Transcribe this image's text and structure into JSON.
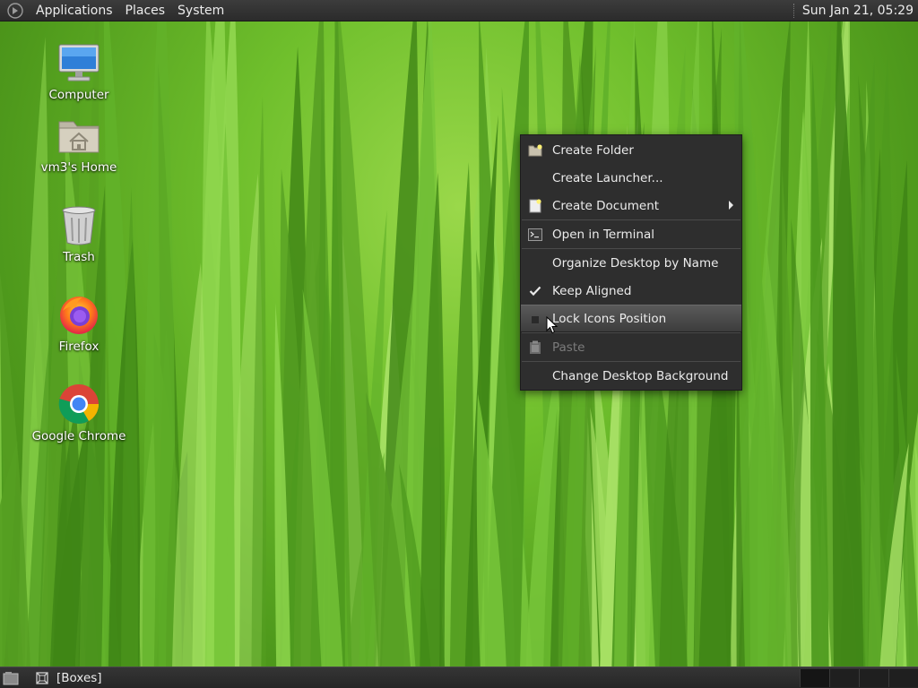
{
  "top_panel": {
    "menus": [
      {
        "label": "Applications"
      },
      {
        "label": "Places"
      },
      {
        "label": "System"
      }
    ],
    "clock": "Sun Jan 21, 05:29"
  },
  "desktop_icons": [
    {
      "label": "Computer",
      "icon": "computer-icon"
    },
    {
      "label": "vm3's Home",
      "icon": "home-folder-icon"
    },
    {
      "label": "Trash",
      "icon": "trash-icon"
    },
    {
      "label": "Firefox",
      "icon": "firefox-icon"
    },
    {
      "label": "Google Chrome",
      "icon": "chrome-icon"
    }
  ],
  "context_menu": {
    "items": [
      {
        "label": "Create Folder",
        "icon": "folder-new-icon"
      },
      {
        "label": "Create Launcher..."
      },
      {
        "label": "Create Document",
        "icon": "document-new-icon",
        "submenu": true
      },
      {
        "label": "Open in Terminal",
        "icon": "terminal-icon"
      },
      {
        "label": "Organize Desktop by Name"
      },
      {
        "label": "Keep Aligned",
        "checked": true
      },
      {
        "label": "Lock Icons Position",
        "checked": false,
        "highlighted": true
      },
      {
        "label": "Paste",
        "icon": "paste-icon",
        "disabled": true
      },
      {
        "label": "Change Desktop Background"
      }
    ]
  },
  "bottom_panel": {
    "task": {
      "label": "[Boxes]"
    },
    "workspace_count": 4
  },
  "colors": {
    "panel_bg": "#2b2b2b",
    "menu_bg": "#2e2e2e",
    "menu_text": "#ececec",
    "disabled_text": "#7b7b7b",
    "wallpaper_green": "#6fbf2c"
  }
}
